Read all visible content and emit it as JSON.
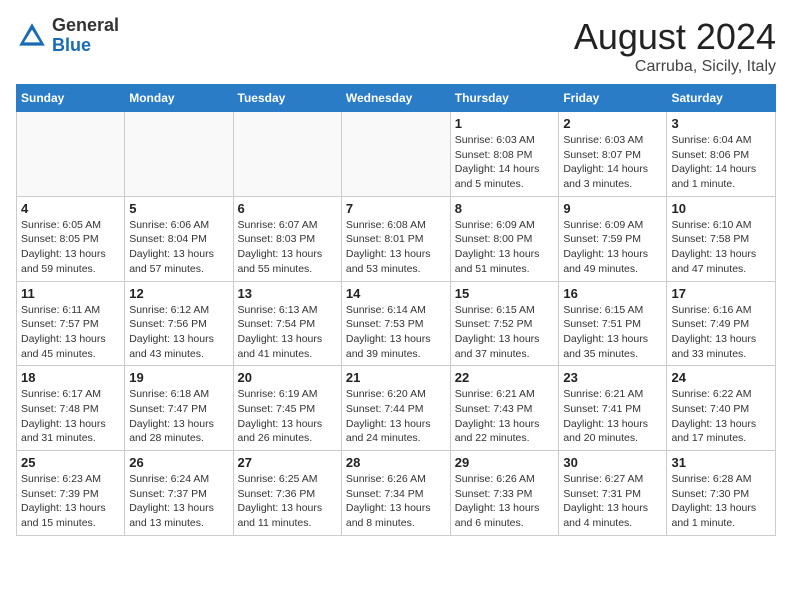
{
  "header": {
    "logo_general": "General",
    "logo_blue": "Blue",
    "month_title": "August 2024",
    "location": "Carruba, Sicily, Italy"
  },
  "weekdays": [
    "Sunday",
    "Monday",
    "Tuesday",
    "Wednesday",
    "Thursday",
    "Friday",
    "Saturday"
  ],
  "weeks": [
    [
      {
        "day": "",
        "info": ""
      },
      {
        "day": "",
        "info": ""
      },
      {
        "day": "",
        "info": ""
      },
      {
        "day": "",
        "info": ""
      },
      {
        "day": "1",
        "info": "Sunrise: 6:03 AM\nSunset: 8:08 PM\nDaylight: 14 hours\nand 5 minutes."
      },
      {
        "day": "2",
        "info": "Sunrise: 6:03 AM\nSunset: 8:07 PM\nDaylight: 14 hours\nand 3 minutes."
      },
      {
        "day": "3",
        "info": "Sunrise: 6:04 AM\nSunset: 8:06 PM\nDaylight: 14 hours\nand 1 minute."
      }
    ],
    [
      {
        "day": "4",
        "info": "Sunrise: 6:05 AM\nSunset: 8:05 PM\nDaylight: 13 hours\nand 59 minutes."
      },
      {
        "day": "5",
        "info": "Sunrise: 6:06 AM\nSunset: 8:04 PM\nDaylight: 13 hours\nand 57 minutes."
      },
      {
        "day": "6",
        "info": "Sunrise: 6:07 AM\nSunset: 8:03 PM\nDaylight: 13 hours\nand 55 minutes."
      },
      {
        "day": "7",
        "info": "Sunrise: 6:08 AM\nSunset: 8:01 PM\nDaylight: 13 hours\nand 53 minutes."
      },
      {
        "day": "8",
        "info": "Sunrise: 6:09 AM\nSunset: 8:00 PM\nDaylight: 13 hours\nand 51 minutes."
      },
      {
        "day": "9",
        "info": "Sunrise: 6:09 AM\nSunset: 7:59 PM\nDaylight: 13 hours\nand 49 minutes."
      },
      {
        "day": "10",
        "info": "Sunrise: 6:10 AM\nSunset: 7:58 PM\nDaylight: 13 hours\nand 47 minutes."
      }
    ],
    [
      {
        "day": "11",
        "info": "Sunrise: 6:11 AM\nSunset: 7:57 PM\nDaylight: 13 hours\nand 45 minutes."
      },
      {
        "day": "12",
        "info": "Sunrise: 6:12 AM\nSunset: 7:56 PM\nDaylight: 13 hours\nand 43 minutes."
      },
      {
        "day": "13",
        "info": "Sunrise: 6:13 AM\nSunset: 7:54 PM\nDaylight: 13 hours\nand 41 minutes."
      },
      {
        "day": "14",
        "info": "Sunrise: 6:14 AM\nSunset: 7:53 PM\nDaylight: 13 hours\nand 39 minutes."
      },
      {
        "day": "15",
        "info": "Sunrise: 6:15 AM\nSunset: 7:52 PM\nDaylight: 13 hours\nand 37 minutes."
      },
      {
        "day": "16",
        "info": "Sunrise: 6:15 AM\nSunset: 7:51 PM\nDaylight: 13 hours\nand 35 minutes."
      },
      {
        "day": "17",
        "info": "Sunrise: 6:16 AM\nSunset: 7:49 PM\nDaylight: 13 hours\nand 33 minutes."
      }
    ],
    [
      {
        "day": "18",
        "info": "Sunrise: 6:17 AM\nSunset: 7:48 PM\nDaylight: 13 hours\nand 31 minutes."
      },
      {
        "day": "19",
        "info": "Sunrise: 6:18 AM\nSunset: 7:47 PM\nDaylight: 13 hours\nand 28 minutes."
      },
      {
        "day": "20",
        "info": "Sunrise: 6:19 AM\nSunset: 7:45 PM\nDaylight: 13 hours\nand 26 minutes."
      },
      {
        "day": "21",
        "info": "Sunrise: 6:20 AM\nSunset: 7:44 PM\nDaylight: 13 hours\nand 24 minutes."
      },
      {
        "day": "22",
        "info": "Sunrise: 6:21 AM\nSunset: 7:43 PM\nDaylight: 13 hours\nand 22 minutes."
      },
      {
        "day": "23",
        "info": "Sunrise: 6:21 AM\nSunset: 7:41 PM\nDaylight: 13 hours\nand 20 minutes."
      },
      {
        "day": "24",
        "info": "Sunrise: 6:22 AM\nSunset: 7:40 PM\nDaylight: 13 hours\nand 17 minutes."
      }
    ],
    [
      {
        "day": "25",
        "info": "Sunrise: 6:23 AM\nSunset: 7:39 PM\nDaylight: 13 hours\nand 15 minutes."
      },
      {
        "day": "26",
        "info": "Sunrise: 6:24 AM\nSunset: 7:37 PM\nDaylight: 13 hours\nand 13 minutes."
      },
      {
        "day": "27",
        "info": "Sunrise: 6:25 AM\nSunset: 7:36 PM\nDaylight: 13 hours\nand 11 minutes."
      },
      {
        "day": "28",
        "info": "Sunrise: 6:26 AM\nSunset: 7:34 PM\nDaylight: 13 hours\nand 8 minutes."
      },
      {
        "day": "29",
        "info": "Sunrise: 6:26 AM\nSunset: 7:33 PM\nDaylight: 13 hours\nand 6 minutes."
      },
      {
        "day": "30",
        "info": "Sunrise: 6:27 AM\nSunset: 7:31 PM\nDaylight: 13 hours\nand 4 minutes."
      },
      {
        "day": "31",
        "info": "Sunrise: 6:28 AM\nSunset: 7:30 PM\nDaylight: 13 hours\nand 1 minute."
      }
    ]
  ]
}
